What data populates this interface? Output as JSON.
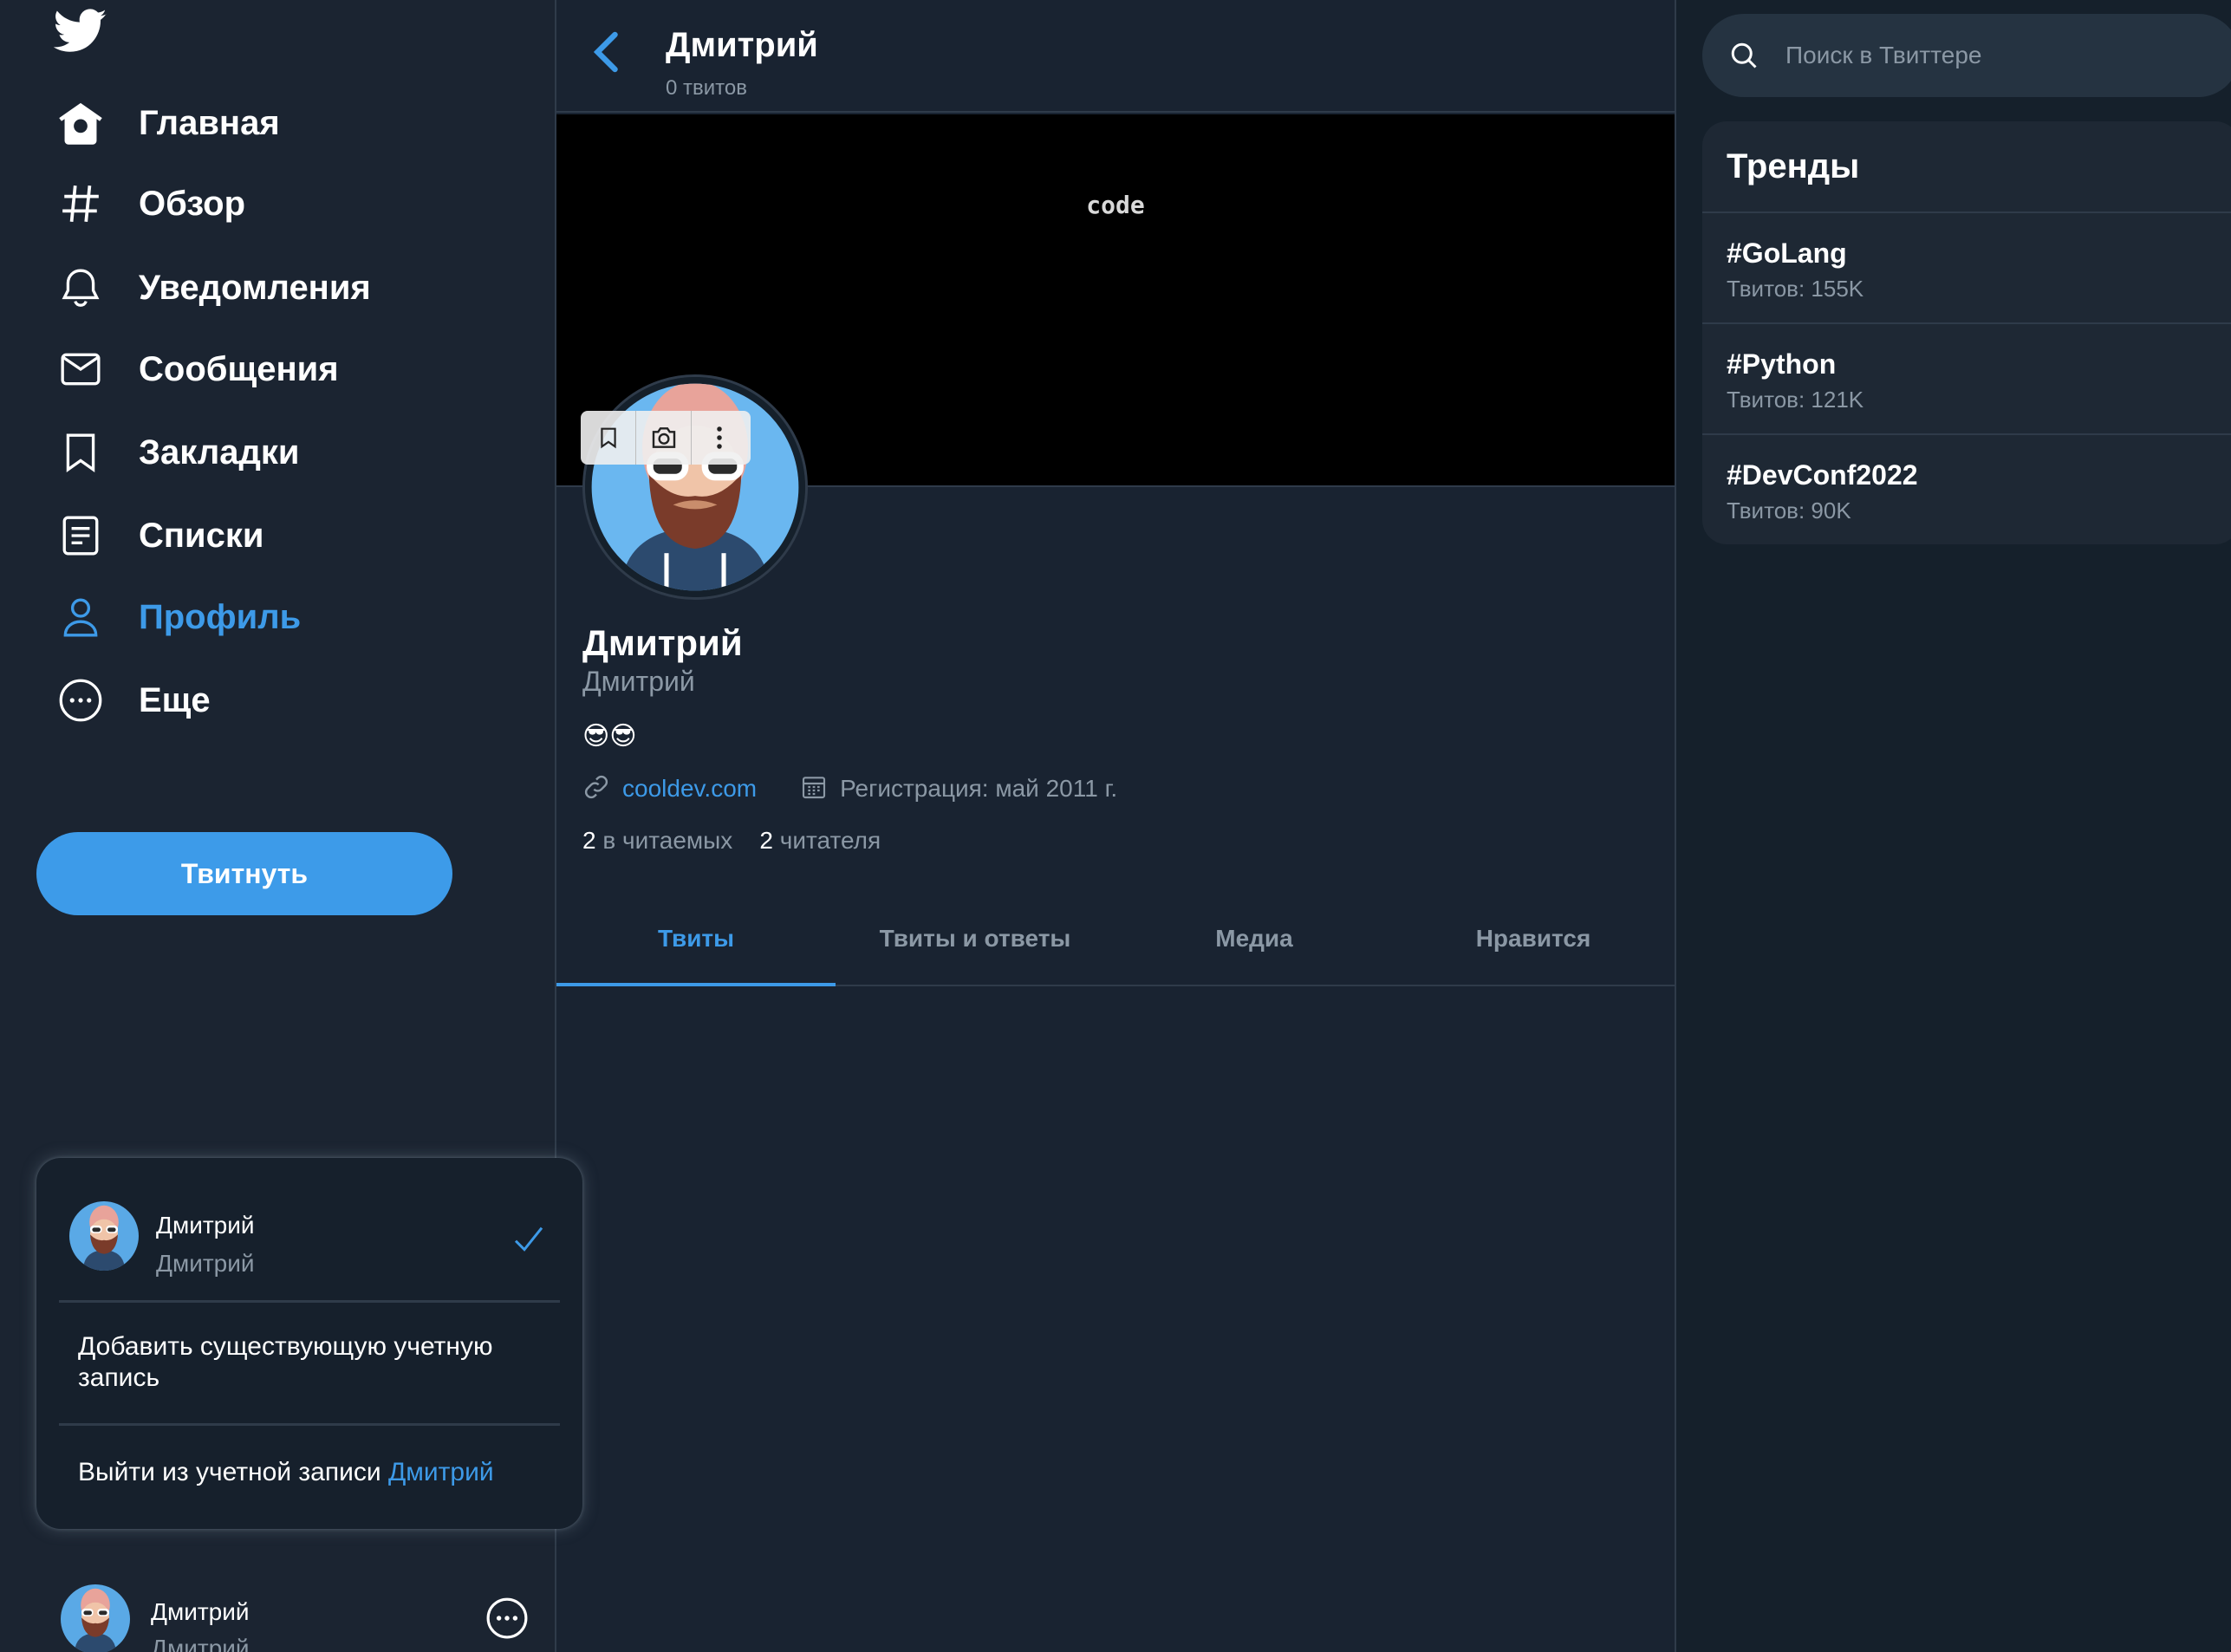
{
  "sidebar": {
    "nav": [
      {
        "label": "Главная",
        "icon": "home-icon"
      },
      {
        "label": "Обзор",
        "icon": "hashtag-icon"
      },
      {
        "label": "Уведомления",
        "icon": "bell-icon"
      },
      {
        "label": "Сообщения",
        "icon": "envelope-icon"
      },
      {
        "label": "Закладки",
        "icon": "bookmark-icon"
      },
      {
        "label": "Списки",
        "icon": "list-icon"
      },
      {
        "label": "Профиль",
        "icon": "user-icon",
        "active": true
      },
      {
        "label": "Еще",
        "icon": "more-circle-icon"
      }
    ],
    "tweet_button": "Твитнуть",
    "account_popup": {
      "name": "Дмитрий",
      "handle": "Дмитрий",
      "add_account": "Добавить существующую учетную запись",
      "logout_prefix": "Выйти из учетной записи",
      "logout_name": "Дмитрий"
    },
    "bottom_account": {
      "name": "Дмитрий",
      "handle": "Дмитрий"
    }
  },
  "main": {
    "header": {
      "title": "Дмитрий",
      "subtitle": "0 твитов"
    },
    "banner_text": "code",
    "profile": {
      "name": "Дмитрий",
      "handle": "Дмитрий",
      "bio": "😎😎",
      "link": "cooldev.com",
      "joined": "Регистрация: май 2011 г.",
      "following_count": "2",
      "following_label": "в читаемых",
      "followers_count": "2",
      "followers_label": "читателя"
    },
    "tabs": [
      {
        "label": "Твиты",
        "active": true
      },
      {
        "label": "Твиты и ответы"
      },
      {
        "label": "Медиа"
      },
      {
        "label": "Нравится"
      }
    ]
  },
  "right": {
    "search_placeholder": "Поиск в Твиттере",
    "trends_title": "Тренды",
    "trends": [
      {
        "tag": "#GoLang",
        "count": "Твитов: 155K"
      },
      {
        "tag": "#Python",
        "count": "Твитов: 121K"
      },
      {
        "tag": "#DevConf2022",
        "count": "Твитов: 90K"
      }
    ]
  },
  "colors": {
    "accent": "#3d9ae8",
    "background": "#15202b",
    "muted_text": "#8b98a5"
  }
}
